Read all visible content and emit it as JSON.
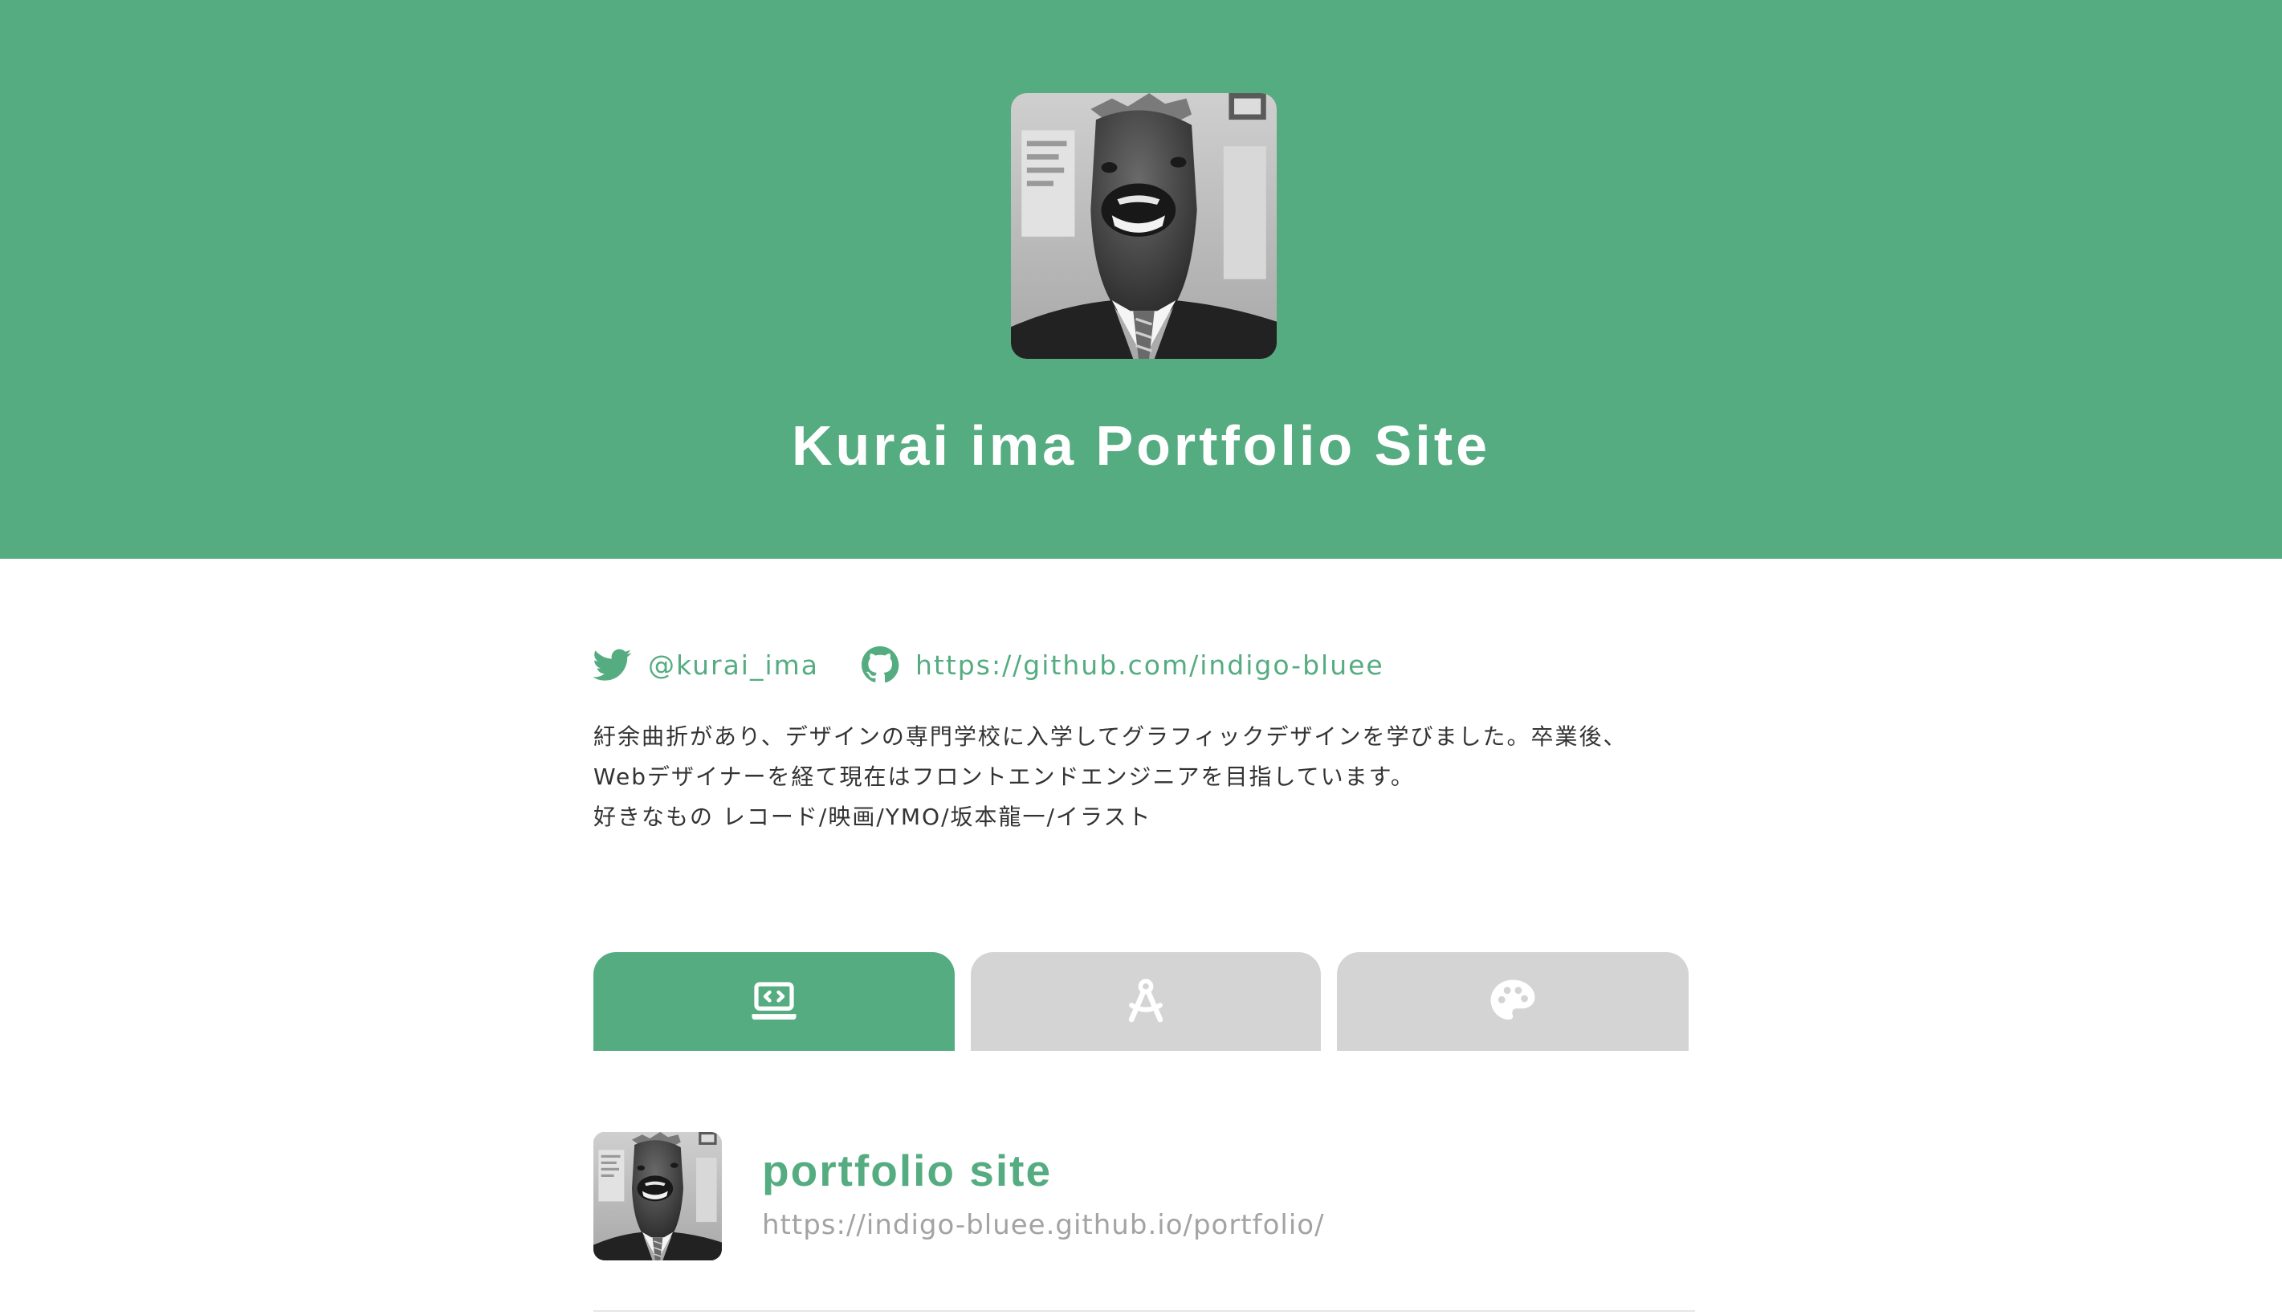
{
  "header": {
    "title": "Kurai ima Portfolio Site",
    "avatar_alt": "horse-mask-portrait"
  },
  "profile": {
    "twitter": {
      "icon": "twitter-icon",
      "handle": "@kurai_ima"
    },
    "github": {
      "icon": "github-icon",
      "url": "https://github.com/indigo-bluee"
    },
    "bio_lines": [
      "紆余曲折があり、デザインの専門学校に入学してグラフィックデザインを学びました。卒業後、",
      "Webデザイナーを経て現在はフロントエンドエンジニアを目指しています。",
      "好きなもの レコード/映画/YMO/坂本龍一/イラスト"
    ]
  },
  "tabs": [
    {
      "icon": "laptop-code-icon",
      "active": true
    },
    {
      "icon": "drafting-compass-icon",
      "active": false
    },
    {
      "icon": "palette-icon",
      "active": false
    }
  ],
  "works": [
    {
      "title": "portfolio site",
      "url": "https://indigo-bluee.github.io/portfolio/",
      "thumb": "horse-mask-portrait"
    }
  ],
  "colors": {
    "accent": "#55ac81",
    "tab_inactive": "#d4d4d4",
    "text": "#333333",
    "muted": "#a3a3a3"
  }
}
